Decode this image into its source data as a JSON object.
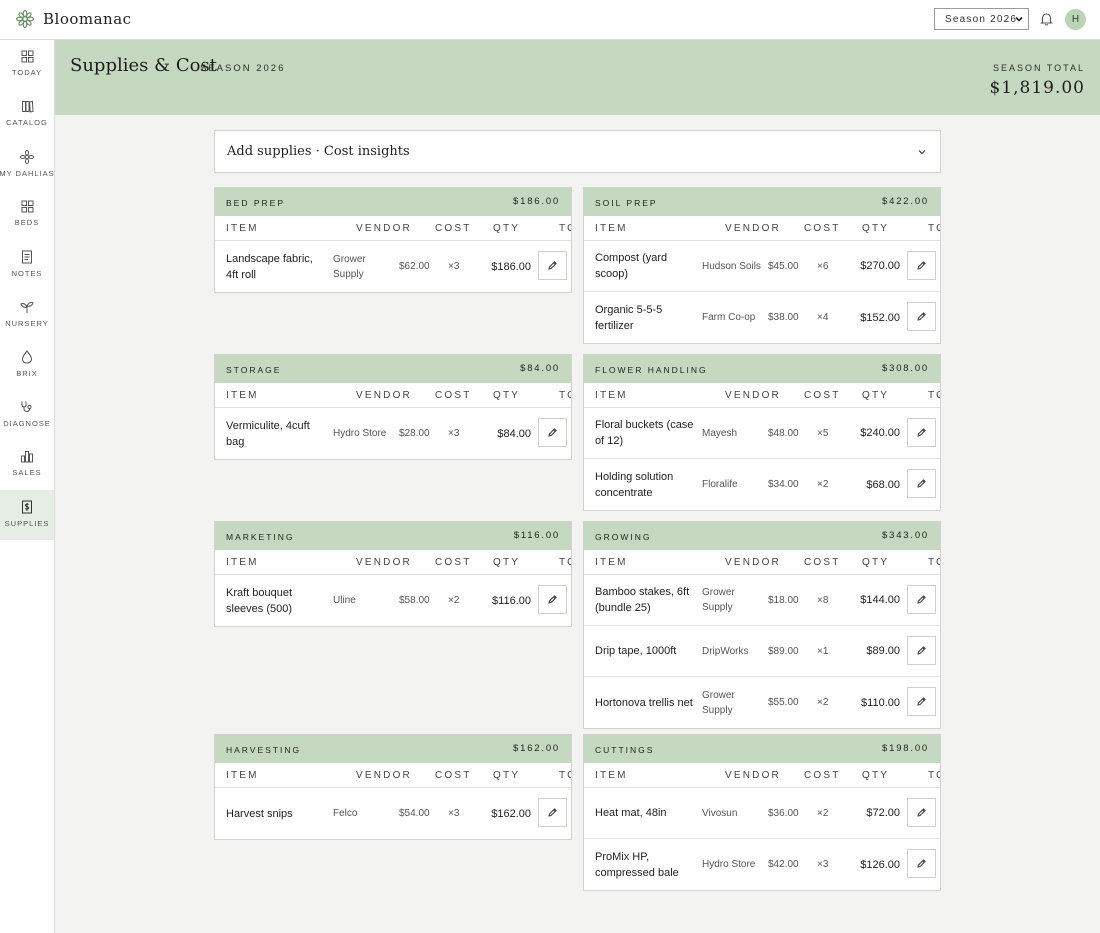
{
  "app": {
    "name": "Bloomanac"
  },
  "topbar": {
    "season": "Season 2026",
    "avatar": "H"
  },
  "sidebar": [
    {
      "label": "TODAY",
      "icon": "grid-icon"
    },
    {
      "label": "CATALOG",
      "icon": "books-icon"
    },
    {
      "label": "MY DAHLIAS",
      "icon": "flower-icon"
    },
    {
      "label": "BEDS",
      "icon": "beds-icon"
    },
    {
      "label": "NOTES",
      "icon": "note-icon"
    },
    {
      "label": "NURSERY",
      "icon": "sprout-icon"
    },
    {
      "label": "BRIX",
      "icon": "drop-icon"
    },
    {
      "label": "DIAGNOSE",
      "icon": "stethoscope-icon"
    },
    {
      "label": "SALES",
      "icon": "bar-chart-icon"
    },
    {
      "label": "SUPPLIES",
      "icon": "dollar-doc-icon",
      "active": true
    }
  ],
  "header": {
    "title": "Supplies & Cost",
    "subtitle": "SEASON 2026",
    "total_label": "SEASON TOTAL",
    "total_value": "$1,819.00"
  },
  "panel": {
    "title": "Add supplies · Cost insights"
  },
  "table_headers": [
    "ITEM",
    "VENDOR",
    "COST",
    "QTY",
    "TO"
  ],
  "categories": [
    {
      "name": "BED PREP",
      "total": "$186.00",
      "items": [
        {
          "item": "Landscape fabric, 4ft roll",
          "vendor": "Grower Supply",
          "cost": "$62.00",
          "qty": "×3",
          "total": "$186.00"
        }
      ]
    },
    {
      "name": "SOIL PREP",
      "total": "$422.00",
      "items": [
        {
          "item": "Compost (yard scoop)",
          "vendor": "Hudson Soils",
          "cost": "$45.00",
          "qty": "×6",
          "total": "$270.00"
        },
        {
          "item": "Organic 5-5-5 fertilizer",
          "vendor": "Farm Co-op",
          "cost": "$38.00",
          "qty": "×4",
          "total": "$152.00"
        }
      ]
    },
    {
      "name": "STORAGE",
      "total": "$84.00",
      "items": [
        {
          "item": "Vermiculite, 4cuft bag",
          "vendor": "Hydro Store",
          "cost": "$28.00",
          "qty": "×3",
          "total": "$84.00"
        }
      ]
    },
    {
      "name": "FLOWER HANDLING",
      "total": "$308.00",
      "items": [
        {
          "item": "Floral buckets (case of 12)",
          "vendor": "Mayesh",
          "cost": "$48.00",
          "qty": "×5",
          "total": "$240.00"
        },
        {
          "item": "Holding solution concentrate",
          "vendor": "Floralife",
          "cost": "$34.00",
          "qty": "×2",
          "total": "$68.00"
        }
      ]
    },
    {
      "name": "MARKETING",
      "total": "$116.00",
      "items": [
        {
          "item": "Kraft bouquet sleeves (500)",
          "vendor": "Uline",
          "cost": "$58.00",
          "qty": "×2",
          "total": "$116.00"
        }
      ]
    },
    {
      "name": "GROWING",
      "total": "$343.00",
      "items": [
        {
          "item": "Bamboo stakes, 6ft (bundle 25)",
          "vendor": "Grower Supply",
          "cost": "$18.00",
          "qty": "×8",
          "total": "$144.00"
        },
        {
          "item": "Drip tape, 1000ft",
          "vendor": "DripWorks",
          "cost": "$89.00",
          "qty": "×1",
          "total": "$89.00"
        },
        {
          "item": "Hortonova trellis net",
          "vendor": "Grower Supply",
          "cost": "$55.00",
          "qty": "×2",
          "total": "$110.00"
        }
      ]
    },
    {
      "name": "HARVESTING",
      "total": "$162.00",
      "items": [
        {
          "item": "Harvest snips",
          "vendor": "Felco",
          "cost": "$54.00",
          "qty": "×3",
          "total": "$162.00"
        }
      ]
    },
    {
      "name": "CUTTINGS",
      "total": "$198.00",
      "items": [
        {
          "item": "Heat mat, 48in",
          "vendor": "Vivosun",
          "cost": "$36.00",
          "qty": "×2",
          "total": "$72.00"
        },
        {
          "item": "ProMix HP, compressed bale",
          "vendor": "Hydro Store",
          "cost": "$42.00",
          "qty": "×3",
          "total": "$126.00"
        }
      ]
    }
  ]
}
